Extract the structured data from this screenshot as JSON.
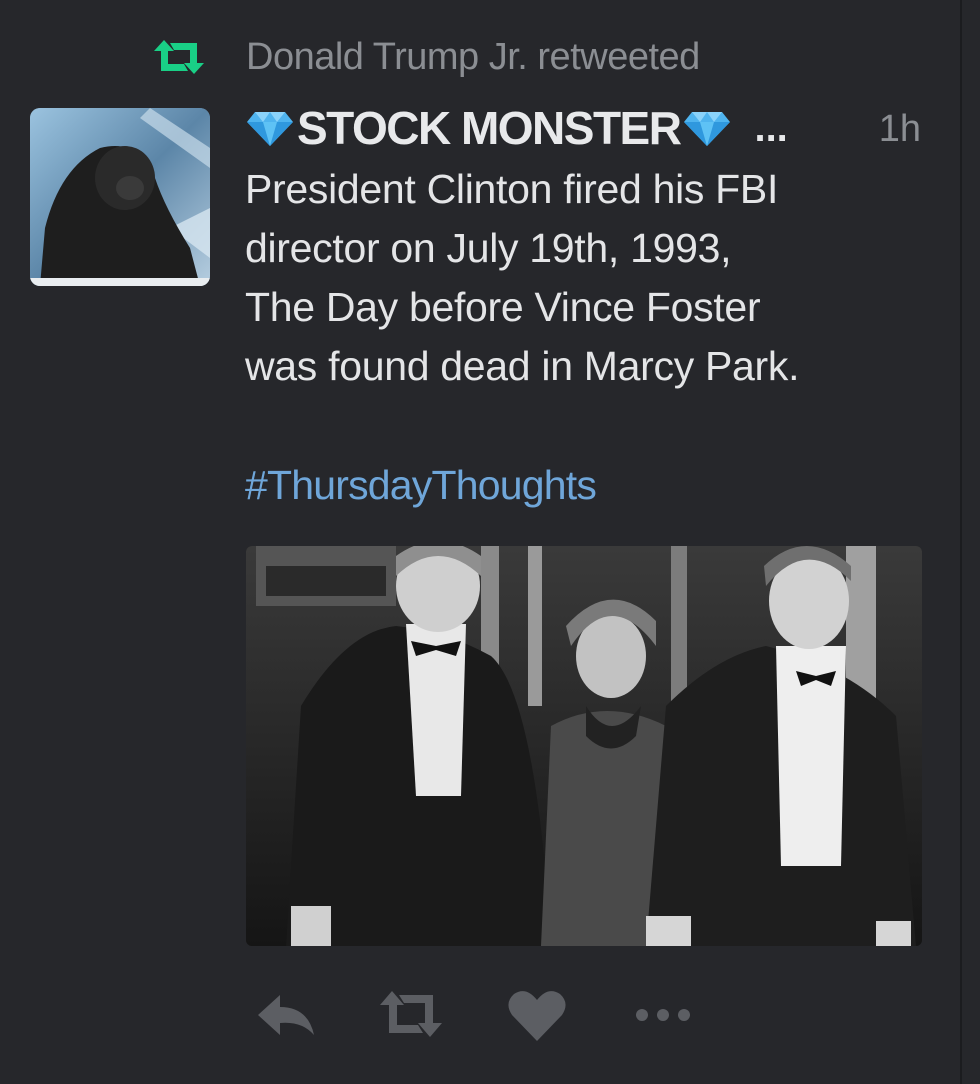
{
  "retweet_context": {
    "icon": "retweet-icon",
    "text": "Donald Trump Jr. retweeted"
  },
  "tweet": {
    "display_name": "STOCK MONSTER",
    "name_decoration_icon": "blue-diamond-icon",
    "ellipsis": "...",
    "timestamp": "1h",
    "body_lines": [
      "President Clinton fired his FBI",
      "director on July 19th, 1993,",
      "The Day before Vince Foster",
      "was found dead in Marcy Park."
    ],
    "hashtag": "#ThursdayThoughts",
    "media_icon": "photo",
    "actions": [
      {
        "name": "reply",
        "icon": "reply-icon"
      },
      {
        "name": "retweet",
        "icon": "retweet-icon"
      },
      {
        "name": "like",
        "icon": "heart-icon"
      },
      {
        "name": "more",
        "icon": "more-icon"
      }
    ]
  },
  "colors": {
    "background": "#26272b",
    "retweet_green": "#19cf86",
    "hashtag_blue": "#6fa6d9",
    "muted": "#8b8e93",
    "action_gray": "#5c5e63",
    "diamond_blue": "#4fb4ef"
  }
}
